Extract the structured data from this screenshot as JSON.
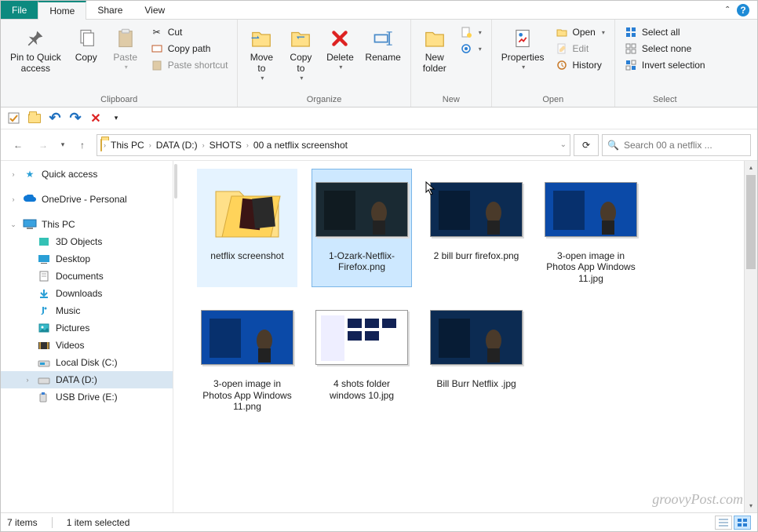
{
  "tabs": {
    "file": "File",
    "home": "Home",
    "share": "Share",
    "view": "View"
  },
  "ribbon": {
    "clipboard": {
      "label": "Clipboard",
      "pin": "Pin to Quick\naccess",
      "copy": "Copy",
      "paste": "Paste",
      "cut": "Cut",
      "copy_path": "Copy path",
      "paste_shortcut": "Paste shortcut"
    },
    "organize": {
      "label": "Organize",
      "move_to": "Move\nto",
      "copy_to": "Copy\nto",
      "delete": "Delete",
      "rename": "Rename"
    },
    "new": {
      "label": "New",
      "new_folder": "New\nfolder"
    },
    "open": {
      "label": "Open",
      "properties": "Properties",
      "open": "Open",
      "edit": "Edit",
      "history": "History"
    },
    "select": {
      "label": "Select",
      "select_all": "Select all",
      "select_none": "Select none",
      "invert": "Invert selection"
    }
  },
  "breadcrumb": [
    "This PC",
    "DATA (D:)",
    "SHOTS",
    "00 a netflix screenshot"
  ],
  "search_placeholder": "Search 00 a netflix ...",
  "tree": {
    "quick_access": "Quick access",
    "onedrive": "OneDrive - Personal",
    "this_pc": "This PC",
    "children": [
      "3D Objects",
      "Desktop",
      "Documents",
      "Downloads",
      "Music",
      "Pictures",
      "Videos",
      "Local Disk (C:)",
      "DATA (D:)",
      "USB Drive (E:)"
    ]
  },
  "items": [
    {
      "name": "netflix screenshot",
      "type": "folder"
    },
    {
      "name": "1-Ozark-Netflix-Firefox.png",
      "type": "image",
      "bg": "#1a2a33",
      "selected": true
    },
    {
      "name": "2 bill burr firefox.png",
      "type": "image",
      "bg": "#0c2b52"
    },
    {
      "name": "3-open image in Photos App Windows 11.jpg",
      "type": "image",
      "bg": "#0b4aa8"
    },
    {
      "name": "3-open image in Photos App Windows 11.png",
      "type": "image",
      "bg": "#0b4aa8"
    },
    {
      "name": "4 shots folder windows 10.jpg",
      "type": "image",
      "bg": "#ffffff"
    },
    {
      "name": "Bill Burr Netflix .jpg",
      "type": "image",
      "bg": "#0c2b52"
    }
  ],
  "status": {
    "count": "7 items",
    "selected": "1 item selected"
  },
  "watermark": "groovyPost.com"
}
